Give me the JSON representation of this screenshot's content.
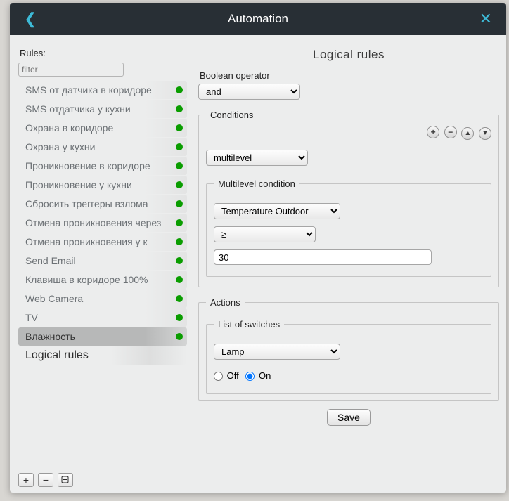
{
  "window": {
    "title": "Automation"
  },
  "sidebar": {
    "rules_label": "Rules:",
    "filter_placeholder": "filter",
    "items": [
      {
        "label": "SMS от датчика в коридоре",
        "status": "green"
      },
      {
        "label": "SMS отдатчика у кухни",
        "status": "green"
      },
      {
        "label": "Охрана в коридоре",
        "status": "green"
      },
      {
        "label": "Охрана у кухни",
        "status": "green"
      },
      {
        "label": "Проникновение в коридоре",
        "status": "green"
      },
      {
        "label": "Проникновение у кухни",
        "status": "green"
      },
      {
        "label": "Сбросить треггеры взлома",
        "status": "green"
      },
      {
        "label": "Отмена проникновения через",
        "status": "green"
      },
      {
        "label": "Отмена проникновения у к",
        "status": "green"
      },
      {
        "label": "Send Email",
        "status": "green"
      },
      {
        "label": "Клавиша в коридоре 100%",
        "status": "green"
      },
      {
        "label": "Web Camera",
        "status": "green"
      },
      {
        "label": "TV",
        "status": "green"
      },
      {
        "label": "Влажность",
        "status": "green",
        "selected": true
      },
      {
        "label": "Logical rules",
        "status": null
      }
    ]
  },
  "detail": {
    "title": "Logical rules",
    "boolean_operator_label": "Boolean operator",
    "boolean_operator_value": "and",
    "conditions": {
      "legend": "Conditions",
      "type_value": "multilevel",
      "multilevel": {
        "legend": "Multilevel condition",
        "sensor_value": "Temperature Outdoor",
        "operator_value": "≥",
        "threshold_value": "30"
      }
    },
    "actions": {
      "legend": "Actions",
      "switches": {
        "legend": "List of switches",
        "device_value": "Lamp",
        "off_label": "Off",
        "on_label": "On",
        "selected": "on"
      }
    },
    "save_label": "Save"
  },
  "footer": {
    "add": "+",
    "remove": "−"
  }
}
